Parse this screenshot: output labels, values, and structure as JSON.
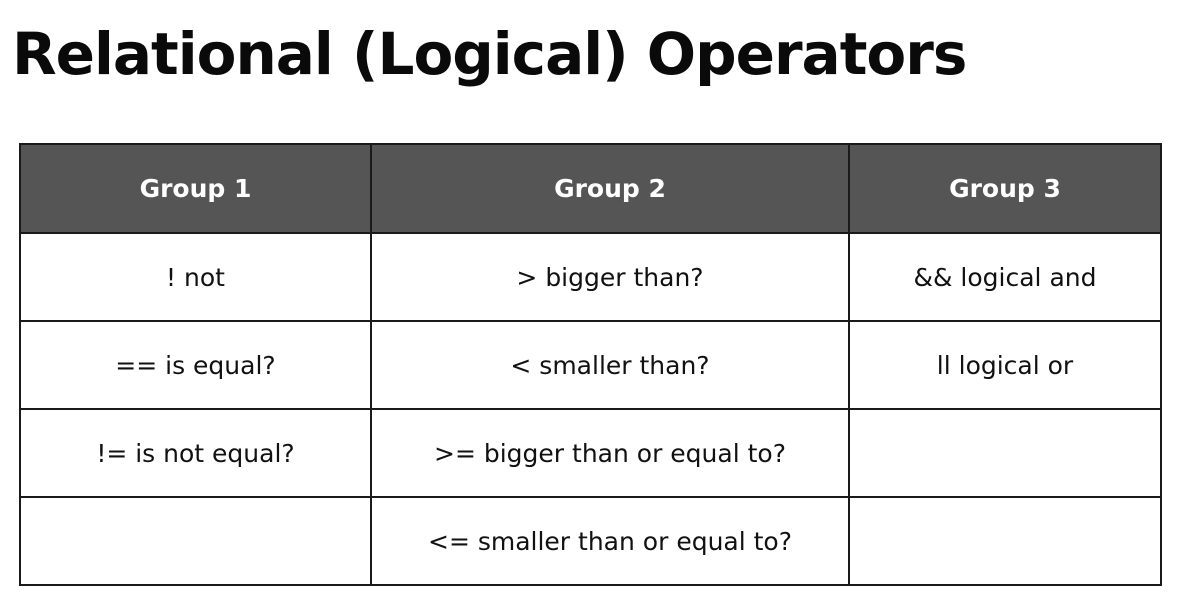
{
  "title": "Relational (Logical) Operators",
  "table": {
    "headers": [
      "Group 1",
      "Group 2",
      "Group 3"
    ],
    "rows": [
      [
        "! not",
        "> bigger than?",
        "&& logical and"
      ],
      [
        "== is equal?",
        "< smaller than?",
        "ll logical or"
      ],
      [
        "!= is not equal?",
        ">= bigger than or equal to?",
        ""
      ],
      [
        "",
        "<= smaller than or equal to?",
        ""
      ]
    ]
  },
  "colors": {
    "header_background": "#555555",
    "header_text": "#ffffff",
    "border": "#1a1a1a",
    "text": "#111111"
  }
}
